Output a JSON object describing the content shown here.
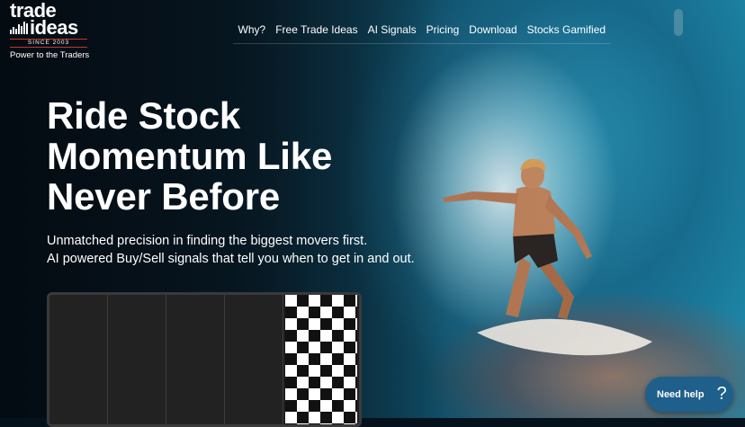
{
  "logo": {
    "line1": "trade",
    "line2": "ideas",
    "since": "SINCE 2003",
    "tagline": "Power to the Traders"
  },
  "nav": {
    "items": [
      "Why?",
      "Free Trade Ideas",
      "AI Signals",
      "Pricing",
      "Download",
      "Stocks Gamified"
    ]
  },
  "hero": {
    "headline": [
      "Ride Stock",
      "Momentum Like",
      "Never Before"
    ],
    "subtext": [
      "Unmatched precision in finding the biggest movers first.",
      "AI powered Buy/Sell signals that tell you when to get in and out."
    ]
  },
  "help_widget": {
    "label": "Need help",
    "icon": "question-mark-icon"
  },
  "colors": {
    "help_button": "#1f5f8b",
    "text": "#ffffff",
    "logo_accent": "#c0392b"
  }
}
